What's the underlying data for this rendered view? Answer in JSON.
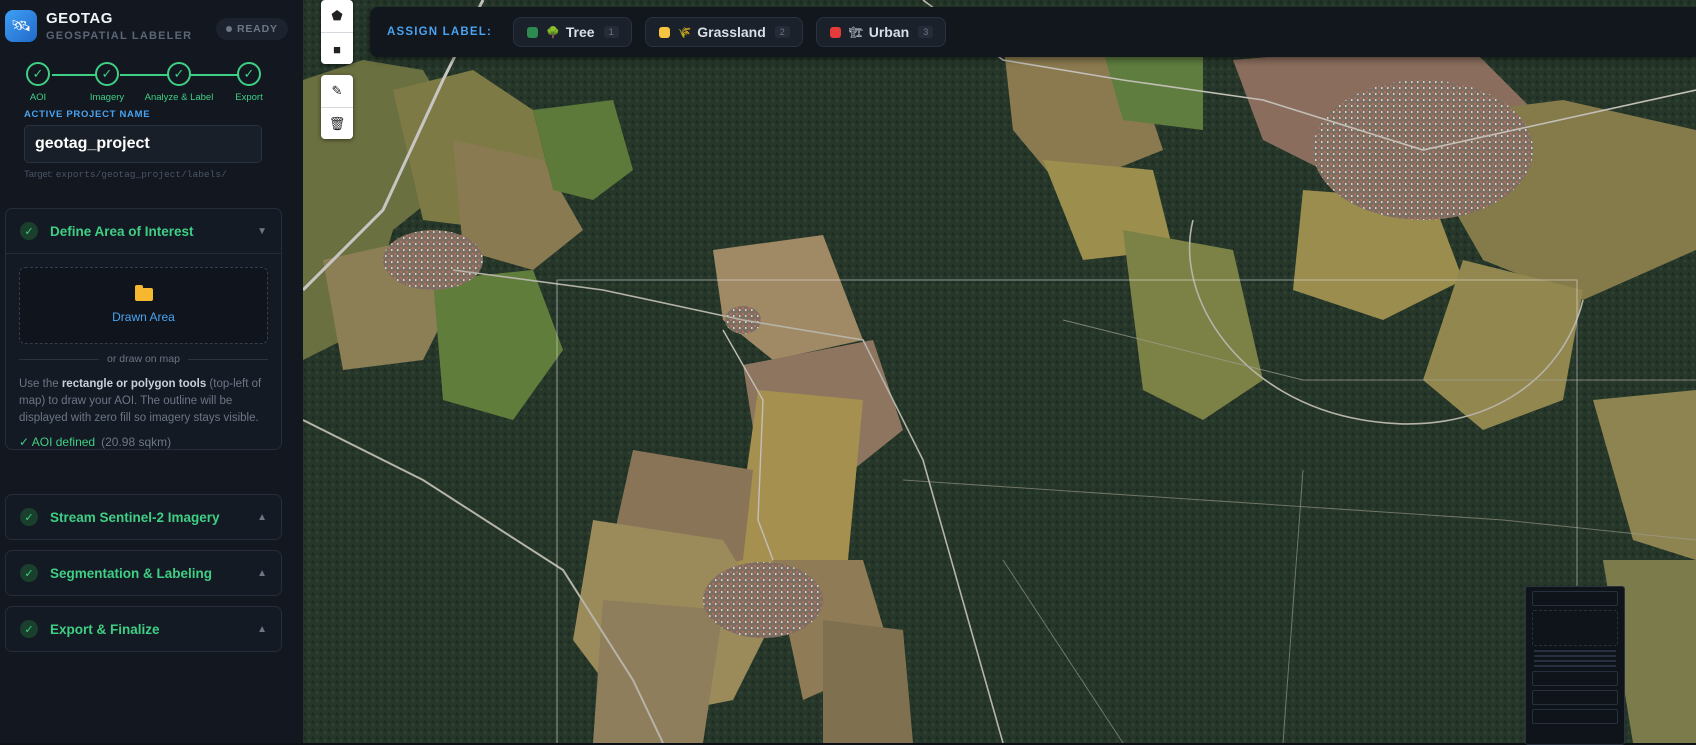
{
  "brand": {
    "title": "GEOTAG",
    "subtitle": "GEOSPATIAL LABELER",
    "status": "READY"
  },
  "stepper": {
    "steps": [
      {
        "label": "AOI"
      },
      {
        "label": "Imagery"
      },
      {
        "label": "Analyze & Label"
      },
      {
        "label": "Export"
      }
    ],
    "check": "✓"
  },
  "project": {
    "label": "ACTIVE PROJECT NAME",
    "value": "geotag_project",
    "target_prefix": "Target: ",
    "target_path": "exports/geotag_project/labels/"
  },
  "panels": {
    "aoi": {
      "title": "Define Area of Interest",
      "drop_label": "Drawn Area",
      "or_text": "or draw on map",
      "help_pre": "Use the ",
      "help_bold": "rectangle or polygon tools",
      "help_post": " (top-left of map) to draw your AOI. The outline will be displayed with zero fill so imagery stays visible.",
      "status": "✓ AOI defined",
      "area": "(20.98 sqkm)"
    },
    "imagery": {
      "title": "Stream Sentinel-2 Imagery"
    },
    "segmentation": {
      "title": "Segmentation & Labeling"
    },
    "export": {
      "title": "Export & Finalize"
    }
  },
  "label_bar": {
    "title": "ASSIGN LABEL:",
    "labels": [
      {
        "name": "Tree",
        "key": "1",
        "color": "#2f8a52",
        "icon": "tree-icon"
      },
      {
        "name": "Grassland",
        "key": "2",
        "color": "#f5c542",
        "icon": "grass-icon"
      },
      {
        "name": "Urban",
        "key": "3",
        "color": "#e63b3b",
        "icon": "building-icon"
      }
    ]
  },
  "draw_tools": {
    "icons": [
      "polygon-icon",
      "rectangle-icon",
      "edit-icon",
      "trash-icon"
    ]
  }
}
